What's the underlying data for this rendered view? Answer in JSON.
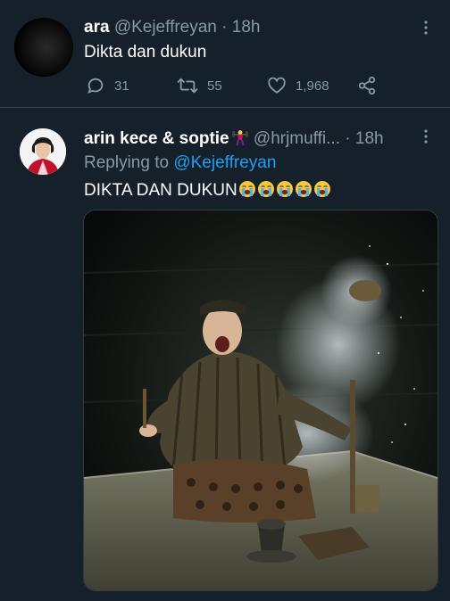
{
  "tweet1": {
    "display_name": "ara",
    "handle": "@Kejeffreyan",
    "separator": "·",
    "time": "18h",
    "text": "Dikta dan dukun",
    "replies": "31",
    "retweets": "55",
    "likes": "1,968",
    "icons": [
      "crescent-moon-avatar",
      "reply-icon",
      "retweet-icon",
      "like-icon",
      "share-icon",
      "more-icon"
    ]
  },
  "tweet2": {
    "display_name": "arin kece & soptie",
    "name_emoji": "weightlifter-emoji",
    "handle": "@hrjmuffi...",
    "separator": "·",
    "time": "18h",
    "replying_prefix": "Replying to",
    "replying_to": "@Kejeffreyan",
    "text": "DIKTA DAN DUKUN",
    "text_emoji": [
      "loudly-crying-face",
      "loudly-crying-face",
      "loudly-crying-face",
      "loudly-crying-face",
      "loudly-crying-face"
    ],
    "media_description_icon": "shaman-meme-photo"
  },
  "colors": {
    "background": "#15202b",
    "text_primary": "#ffffff",
    "text_secondary": "#8899a6",
    "accent": "#1da1f2",
    "divider": "#38444d"
  }
}
